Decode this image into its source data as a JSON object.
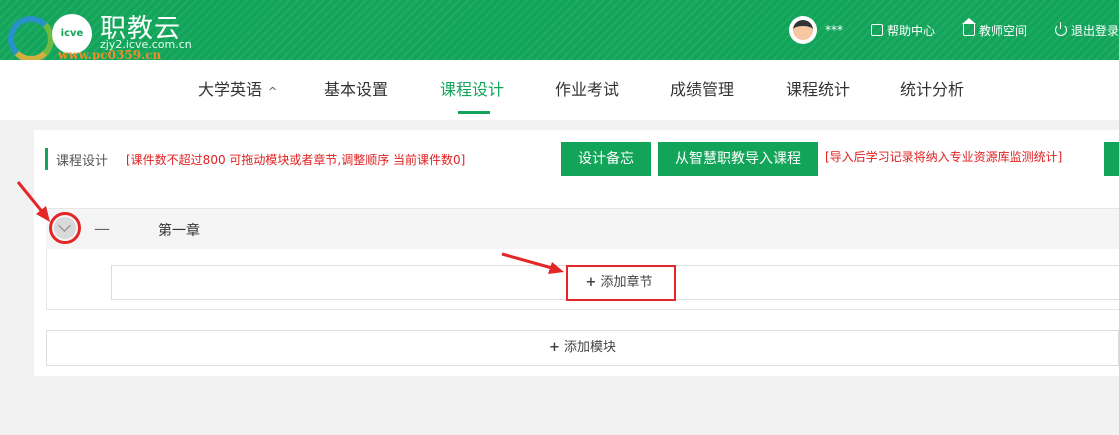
{
  "header": {
    "watermark_text": "www.pc0359.cn",
    "logo_badge": "icve",
    "logo_title": "职教云",
    "logo_domain": "zjy2.icve.com.cn",
    "user_name": "***",
    "links": [
      {
        "label": "帮助中心",
        "icon": "help-icon"
      },
      {
        "label": "教师空间",
        "icon": "home-icon"
      },
      {
        "label": "退出登录",
        "icon": "power-icon"
      }
    ]
  },
  "course_nav": {
    "course_label": "大学英语",
    "course_caret": "^",
    "items": [
      "基本设置",
      "课程设计",
      "作业考试",
      "成绩管理",
      "课程统计",
      "统计分析"
    ],
    "active": "课程设计"
  },
  "toolbar": {
    "title": "课程设计",
    "note": "[课件数不超过800 可拖动模块或者章节,调整顺序 当前课件数0]",
    "btn_memo": "设计备忘",
    "btn_import": "从智慧职教导入课程",
    "import_note": "[导入后学习记录将纳入专业资源库监测统计]"
  },
  "chapter": {
    "dash": "—",
    "name": "第一章",
    "add_section": "添加章节"
  },
  "add_module": "添加模块",
  "colors": {
    "brand_green": "#12a55a",
    "annotation_red": "#e52626",
    "note_red": "#e02020"
  }
}
